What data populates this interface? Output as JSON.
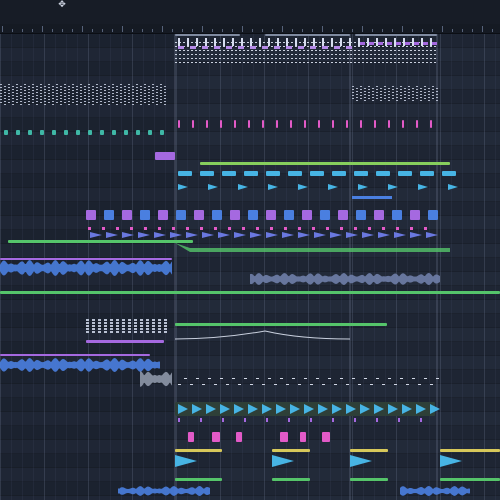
{
  "app": {
    "cursor_icon": "move-cursor-icon"
  },
  "colors": {
    "background": "#202735",
    "teal": "#3fb7a6",
    "green": "#55c46a",
    "purple": "#a569e0",
    "blue": "#4a7fe0",
    "pink": "#e25ac7",
    "cyan": "#47b4e4",
    "yellow": "#d7c85a"
  }
}
